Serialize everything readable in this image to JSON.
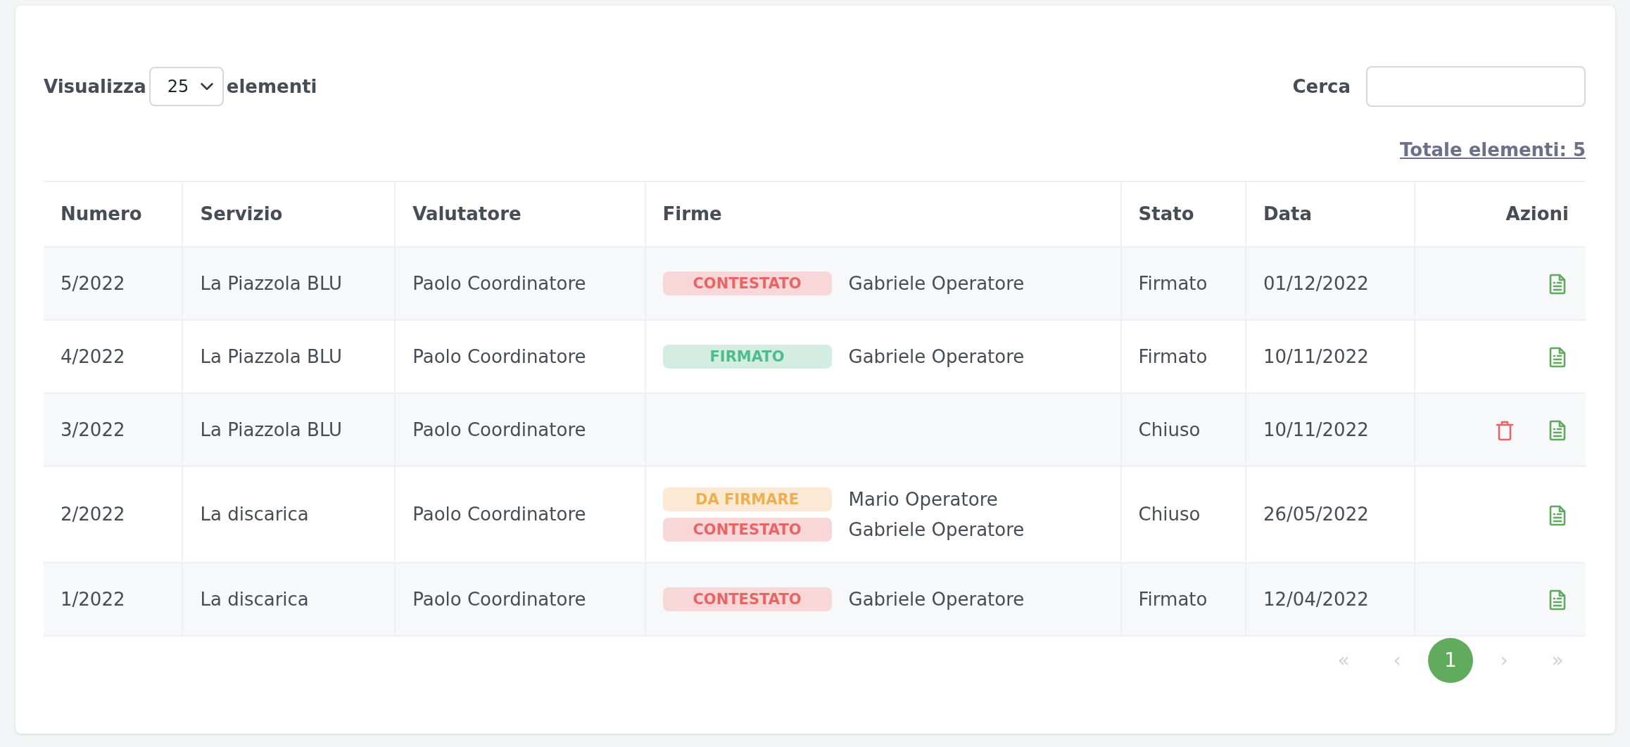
{
  "length_control": {
    "label_before": "Visualizza",
    "value": "25",
    "label_after": "elementi"
  },
  "search": {
    "label": "Cerca"
  },
  "total": "Totale elementi: 5",
  "table": {
    "columns": [
      "Numero",
      "Servizio",
      "Valutatore",
      "Firme",
      "Stato",
      "Data",
      "Azioni"
    ],
    "rows": [
      {
        "numero": "5/2022",
        "servizio": "La Piazzola BLU",
        "valutatore": "Paolo Coordinatore",
        "firme": [
          {
            "kind": "contestato",
            "badge": "CONTESTATO",
            "name": "Gabriele Operatore"
          }
        ],
        "stato": "Firmato",
        "data": "01/12/2022",
        "actions": [
          {
            "kind": "document"
          }
        ]
      },
      {
        "numero": "4/2022",
        "servizio": "La Piazzola BLU",
        "valutatore": "Paolo Coordinatore",
        "firme": [
          {
            "kind": "firmato",
            "badge": "FIRMATO",
            "name": "Gabriele Operatore"
          }
        ],
        "stato": "Firmato",
        "data": "10/11/2022",
        "actions": [
          {
            "kind": "document"
          }
        ]
      },
      {
        "numero": "3/2022",
        "servizio": "La Piazzola BLU",
        "valutatore": "Paolo Coordinatore",
        "firme": [],
        "stato": "Chiuso",
        "data": "10/11/2022",
        "actions": [
          {
            "kind": "delete"
          },
          {
            "kind": "document"
          }
        ]
      },
      {
        "numero": "2/2022",
        "servizio": "La discarica",
        "valutatore": "Paolo Coordinatore",
        "firme": [
          {
            "kind": "da_firmare",
            "badge": "DA FIRMARE",
            "name": "Mario Operatore"
          },
          {
            "kind": "contestato",
            "badge": "CONTESTATO",
            "name": "Gabriele Operatore"
          }
        ],
        "stato": "Chiuso",
        "data": "26/05/2022",
        "actions": [
          {
            "kind": "document"
          }
        ]
      },
      {
        "numero": "1/2022",
        "servizio": "La discarica",
        "valutatore": "Paolo Coordinatore",
        "firme": [
          {
            "kind": "contestato",
            "badge": "CONTESTATO",
            "name": "Gabriele Operatore"
          }
        ],
        "stato": "Firmato",
        "data": "12/04/2022",
        "actions": [
          {
            "kind": "document"
          }
        ]
      }
    ]
  },
  "pagination": [
    {
      "label": "«",
      "selected": false,
      "disabled": true
    },
    {
      "label": "‹",
      "selected": false,
      "disabled": true
    },
    {
      "label": "1",
      "selected": true,
      "disabled": false
    },
    {
      "label": "›",
      "selected": false,
      "disabled": true
    },
    {
      "label": "»",
      "selected": false,
      "disabled": true
    }
  ]
}
